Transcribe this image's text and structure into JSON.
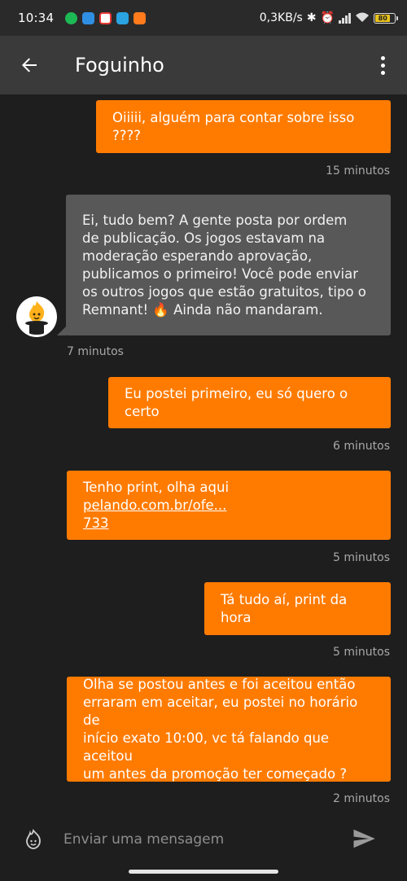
{
  "status_bar": {
    "time": "10:34",
    "network_speed": "0,3KB/s",
    "battery_level": "80",
    "notification_icons": [
      {
        "name": "spotify-icon",
        "color": "#1db954"
      },
      {
        "name": "messages-icon",
        "color": "#2f8fe3"
      },
      {
        "name": "news-icon",
        "color": "#e53935"
      },
      {
        "name": "telegram-icon",
        "color": "#2aa3e0"
      },
      {
        "name": "app-icon",
        "color": "#ff7b1c"
      }
    ]
  },
  "header": {
    "title": "Foguinho"
  },
  "messages": [
    {
      "direction": "outgoing",
      "text": "Oiiiii, alguém para contar sobre isso ????",
      "time": "15 minutos"
    },
    {
      "direction": "incoming",
      "text": "Ei, tudo bem? A gente posta por ordem\nde publicação. Os jogos estavam na\nmoderação esperando aprovação,\npublicamos o primeiro! Você pode enviar\nos outros jogos que estão gratuitos, tipo o\nRemnant! 🔥 Ainda não mandaram.",
      "time": "7 minutos"
    },
    {
      "direction": "outgoing",
      "text": "Eu postei primeiro, eu só quero o certo",
      "time": "6 minutos"
    },
    {
      "direction": "outgoing",
      "text_prefix": "Tenho print, olha aqui ",
      "link": "pelando.com.br/ofe...\n733",
      "time": "5 minutos"
    },
    {
      "direction": "outgoing",
      "text": "Tá tudo aí, print da hora",
      "time": "5 minutos"
    },
    {
      "direction": "outgoing",
      "text": "Olha se postou antes e foi aceitou então\nerraram em aceitar, eu postei no horário de\ninício exato 10:00, vc tá falando que aceitou\num antes da promoção ter começado ?",
      "time": "2 minutos"
    }
  ],
  "composer": {
    "placeholder": "Enviar uma mensagem"
  },
  "colors": {
    "outgoing_bubble": "#ff7b00",
    "incoming_bubble": "#585858",
    "background": "#1e1e1e",
    "app_bar": "#3a3a3a"
  }
}
